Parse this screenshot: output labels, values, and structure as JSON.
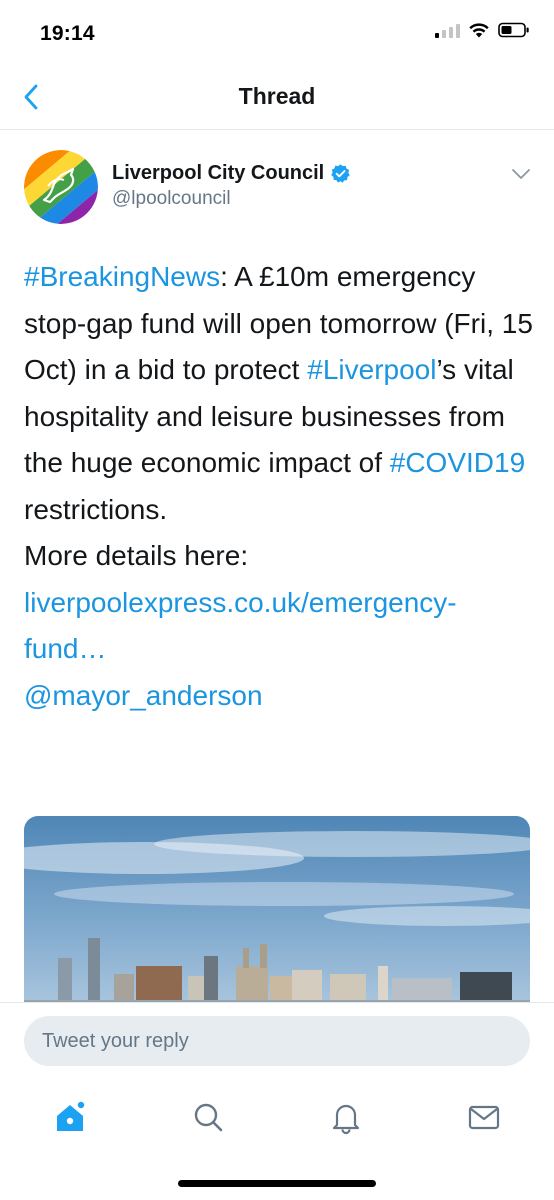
{
  "status_bar": {
    "time": "19:14"
  },
  "nav": {
    "title": "Thread"
  },
  "tweet": {
    "author_name": "Liverpool City Council",
    "author_handle": "@lpoolcouncil",
    "paragraph1": [
      {
        "text": "#BreakingNews",
        "link": true
      },
      {
        "text": ": A £10m emergency stop-gap fund will open tomorrow (Fri, 15 Oct) in a bid to protect ",
        "link": false
      },
      {
        "text": "#Liverpool",
        "link": true
      },
      {
        "text": "’s vital hospitality and leisure businesses from the huge economic impact of ",
        "link": false
      },
      {
        "text": "#COVID19",
        "link": true
      },
      {
        "text": " restrictions.",
        "link": false
      }
    ],
    "more_label": "More details here:",
    "url_text": "liverpoolexpress.co.uk/emergency-fund…",
    "mention": "@mayor_anderson"
  },
  "reply": {
    "placeholder": "Tweet your reply"
  },
  "tabs": [
    {
      "icon": "home-icon",
      "active": true
    },
    {
      "icon": "search-icon",
      "active": false
    },
    {
      "icon": "bell-icon",
      "active": false
    },
    {
      "icon": "mail-icon",
      "active": false
    }
  ],
  "colors": {
    "accent": "#1da1f2",
    "link": "#1b95e0",
    "muted": "#657786"
  }
}
